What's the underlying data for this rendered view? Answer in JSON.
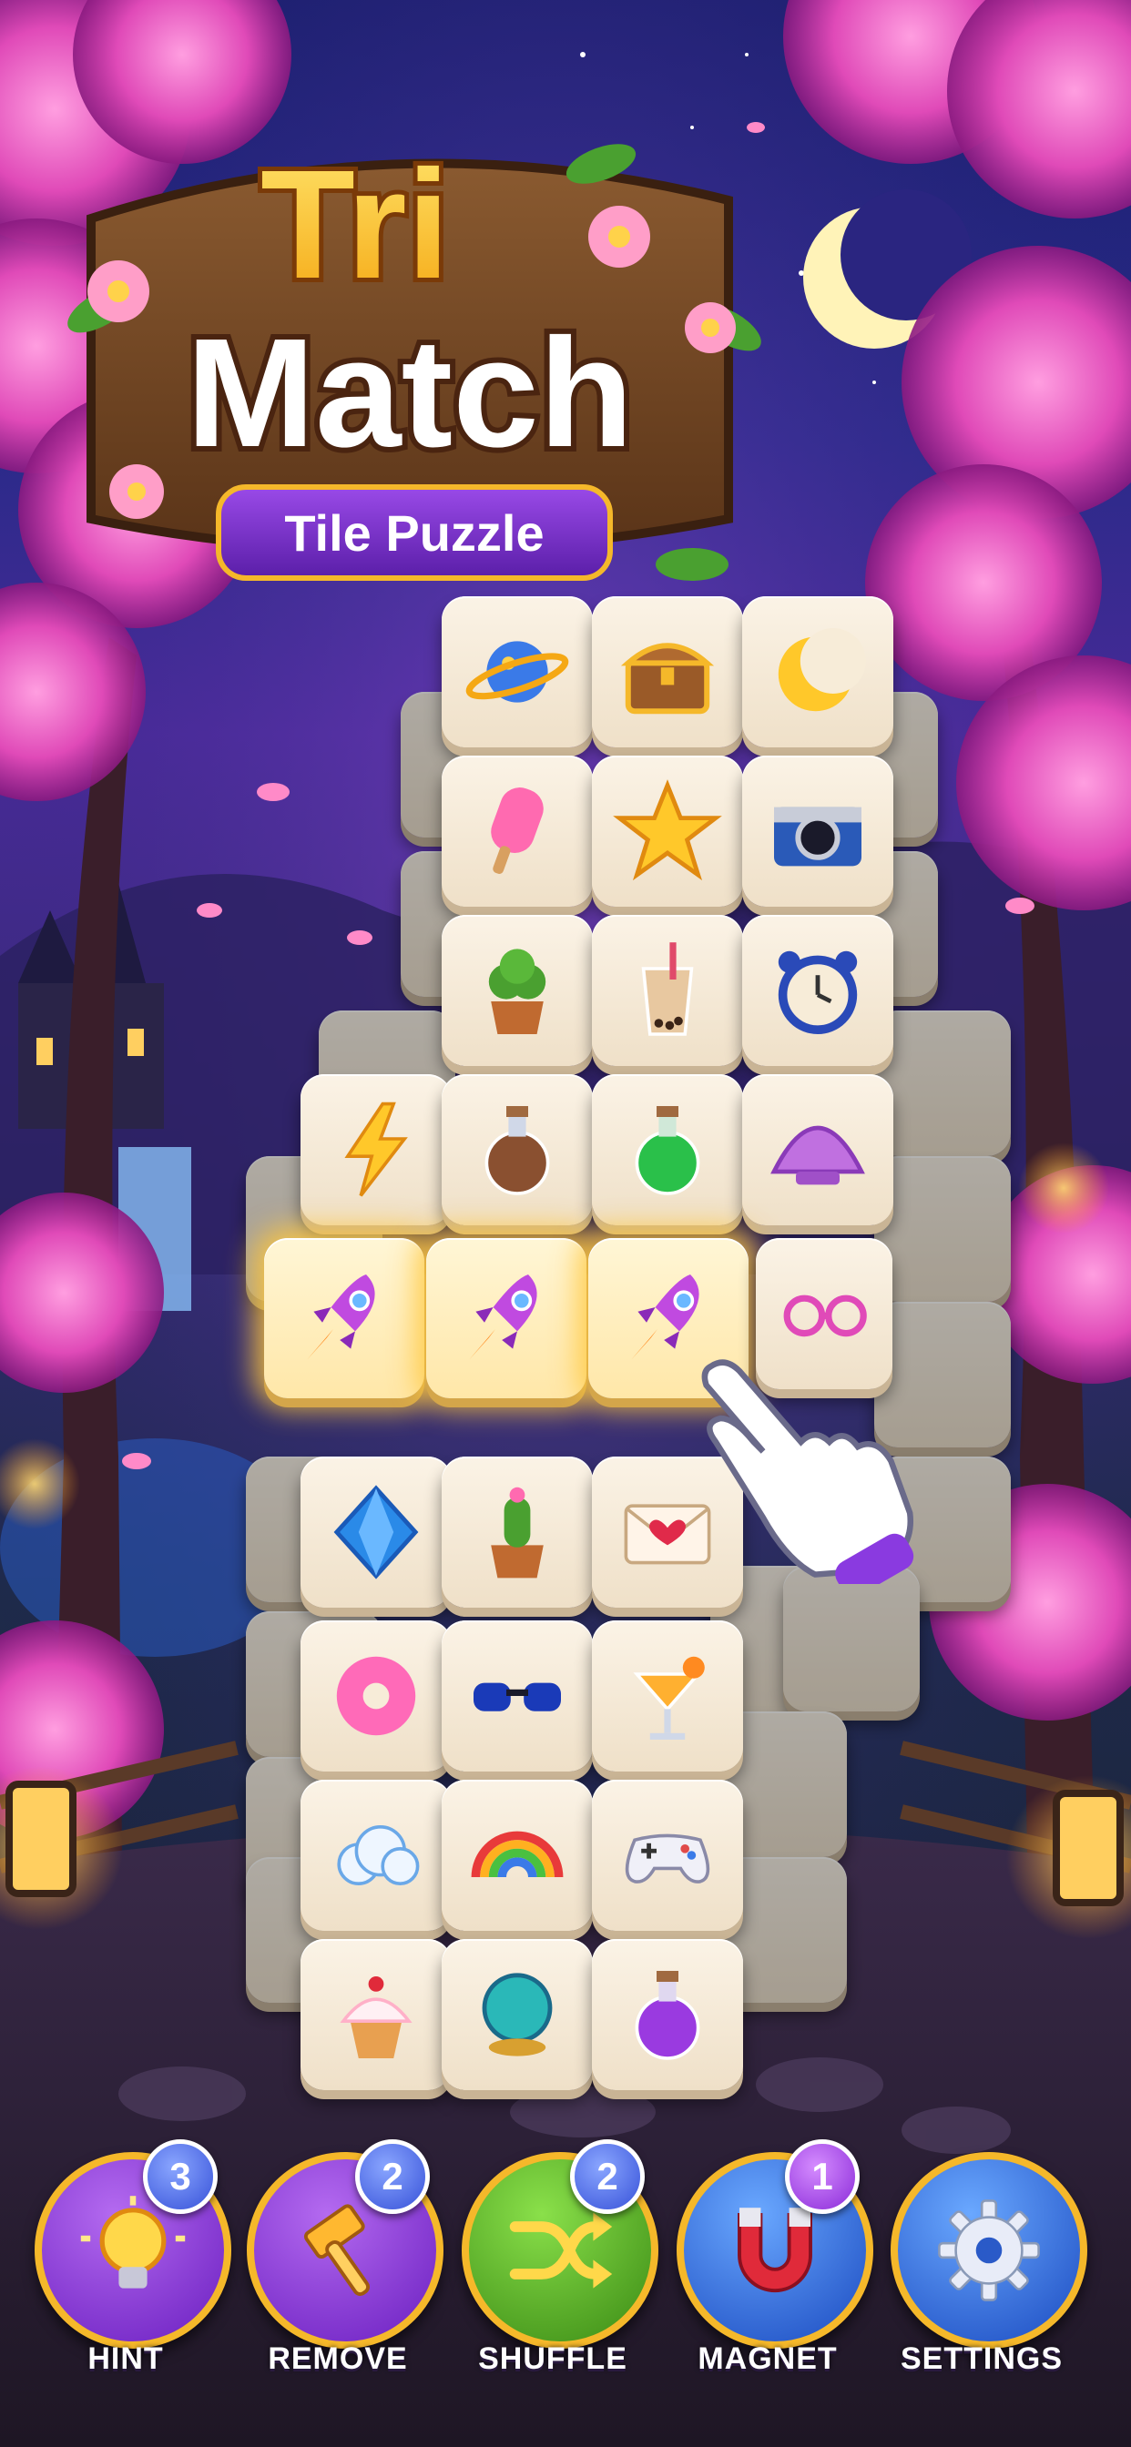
{
  "logo": {
    "line1": "Tri",
    "line2": "Match",
    "subtitle": "Tile Puzzle"
  },
  "board": {
    "tiles": [
      {
        "icon": "planet-icon",
        "state": "normal"
      },
      {
        "icon": "treasure-chest-icon",
        "state": "normal"
      },
      {
        "icon": "crescent-moon-icon",
        "state": "normal"
      },
      {
        "icon": "popsicle-icon",
        "state": "normal"
      },
      {
        "icon": "star-icon",
        "state": "normal"
      },
      {
        "icon": "camera-icon",
        "state": "normal"
      },
      {
        "icon": "potted-plant-icon",
        "state": "normal"
      },
      {
        "icon": "bubble-tea-icon",
        "state": "normal"
      },
      {
        "icon": "alarm-clock-icon",
        "state": "normal"
      },
      {
        "icon": "lightning-icon",
        "state": "normal"
      },
      {
        "icon": "brown-potion-icon",
        "state": "normal"
      },
      {
        "icon": "green-potion-icon",
        "state": "normal"
      },
      {
        "icon": "seashell-icon",
        "state": "normal"
      },
      {
        "icon": "rocket-icon",
        "state": "selected"
      },
      {
        "icon": "rocket-icon",
        "state": "selected"
      },
      {
        "icon": "rocket-icon",
        "state": "selected"
      },
      {
        "icon": "pink-glasses-icon",
        "state": "normal"
      },
      {
        "icon": "gem-icon",
        "state": "normal"
      },
      {
        "icon": "cactus-icon",
        "state": "normal"
      },
      {
        "icon": "love-letter-icon",
        "state": "normal"
      },
      {
        "icon": "donut-icon",
        "state": "normal"
      },
      {
        "icon": "sunglasses-icon",
        "state": "normal"
      },
      {
        "icon": "cocktail-icon",
        "state": "normal"
      },
      {
        "icon": "cloud-icon",
        "state": "normal"
      },
      {
        "icon": "rainbow-icon",
        "state": "normal"
      },
      {
        "icon": "game-controller-icon",
        "state": "normal"
      },
      {
        "icon": "cupcake-icon",
        "state": "normal"
      },
      {
        "icon": "crystal-ball-icon",
        "state": "normal"
      },
      {
        "icon": "purple-potion-icon",
        "state": "normal"
      }
    ]
  },
  "toolbar": {
    "hint": {
      "label": "HINT",
      "count": "3",
      "icon": "lightbulb-icon",
      "color": "#7b2fd0"
    },
    "remove": {
      "label": "REMOVE",
      "count": "2",
      "icon": "hammer-icon",
      "color": "#7b2fd0"
    },
    "shuffle": {
      "label": "SHUFFLE",
      "count": "2",
      "icon": "shuffle-icon",
      "color": "#4aa020"
    },
    "magnet": {
      "label": "MAGNET",
      "count": "1",
      "icon": "magnet-icon",
      "color": "#2a6ae0"
    },
    "settings": {
      "label": "SETTINGS",
      "icon": "gear-icon",
      "color": "#2a6ae0"
    }
  },
  "colors": {
    "accent_gold": "#f5b82a",
    "tile_face": "#f7ecd8",
    "badge_blue": "#3651d8",
    "badge_purple": "#8a2ad8"
  }
}
